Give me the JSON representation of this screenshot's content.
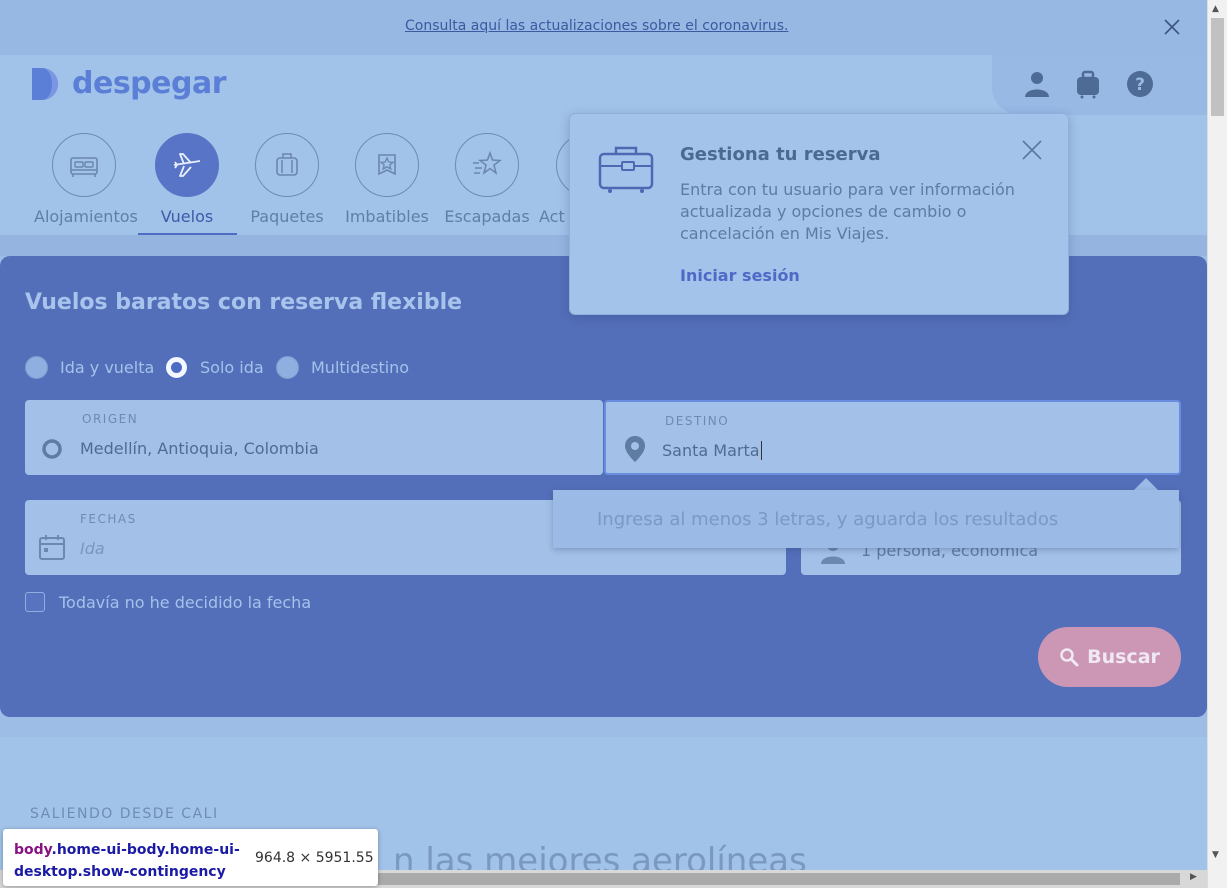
{
  "banner": {
    "link_text": "Consulta aquí las actualizaciones sobre el coronavirus."
  },
  "header": {
    "logo_text": "despegar",
    "nav": [
      {
        "label": "Alojamientos",
        "icon": "bed-icon",
        "active": false
      },
      {
        "label": "Vuelos",
        "icon": "plane-icon",
        "active": true
      },
      {
        "label": "Paquetes",
        "icon": "luggage-icon",
        "active": false
      },
      {
        "label": "Imbatibles",
        "icon": "badge-star-icon",
        "active": false
      },
      {
        "label": "Escapadas",
        "icon": "star-speed-icon",
        "active": false
      },
      {
        "label": "Act",
        "icon": "activities-icon",
        "active": false
      }
    ]
  },
  "popover": {
    "title": "Gestiona tu reserva",
    "text": "Entra con tu usuario para ver información actualizada y opciones de cambio o cancelación en Mis Viajes.",
    "link": "Iniciar sesión"
  },
  "search": {
    "title": "Vuelos baratos con reserva flexible",
    "trip_types": [
      {
        "label": "Ida y vuelta",
        "checked": false
      },
      {
        "label": "Solo ida",
        "checked": true
      },
      {
        "label": "Multidestino",
        "checked": false
      }
    ],
    "origin": {
      "label": "ORIGEN",
      "value": "Medellín, Antioquia, Colombia"
    },
    "destination": {
      "label": "DESTINO",
      "value": "Santa Marta"
    },
    "suggestion": "Ingresa al menos 3 letras, y aguarda los resultados",
    "dates": {
      "label": "FECHAS",
      "placeholder": "Ida"
    },
    "passengers": {
      "value": "1 persona, económica"
    },
    "undecided_label": "Todavía no he decidido la fecha",
    "search_button": "Buscar"
  },
  "lower": {
    "section_label": "SALIENDO DESDE CALI",
    "heading": "n las mejores aerolíneas"
  },
  "devtools": {
    "tag": "body",
    "classes": ".home-ui-body.home-ui-desktop.show-contingency",
    "dimensions": "964.8 × 5951.55"
  },
  "colors": {
    "panel": "#546fb9",
    "accent": "#5874c6",
    "search_button": "#cc97b5"
  }
}
